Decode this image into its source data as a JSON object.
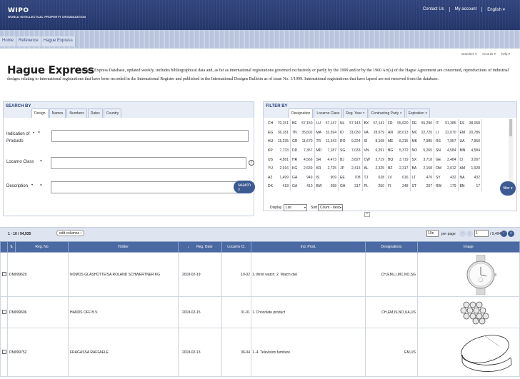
{
  "header": {
    "logo_main": "WIPO",
    "logo_sub": "WORLD INTELLECTUAL PROPERTY ORGANIZATION",
    "links": [
      "Contact Us",
      "My account",
      "English"
    ]
  },
  "breadcrumb": [
    "Home",
    "Reference",
    "Hague Express"
  ],
  "helpers": [
    "searches",
    "records",
    "help"
  ],
  "page": {
    "title": "Hague Express",
    "description": "The Hague Express Database, updated weekly, includes bibliographical data and, as far as international registrations governed exclusively or partly by the 1999 and/or by the 1960 Act(s) of the Hague Agreement are concerned, reproductions of industrial designs relating to international registrations that have been recorded in the International Register and published in the International Designs Bulletin as of issue No. 1/1999. International registrations that have lapsed are not removed from the database."
  },
  "search_by": {
    "title": "SEARCH BY",
    "tabs": [
      "Design",
      "Names",
      "Numbers",
      "Dates",
      "Country"
    ],
    "fields": [
      {
        "label": "Indication of Products",
        "op": "="
      },
      {
        "label": "Locarno Class",
        "op": "="
      },
      {
        "label": "Description",
        "op": "="
      }
    ],
    "search_button": "search"
  },
  "filter_by": {
    "title": "FILTER BY",
    "tabs": [
      "Designation",
      "Locarno Class",
      "Reg. Year",
      "Contracting Party",
      "Expiration"
    ],
    "rows": [
      [
        [
          "CH",
          "70,151"
        ],
        [
          "BE",
          "57,150"
        ],
        [
          "LU",
          "57,147"
        ],
        [
          "NL",
          "57,143"
        ],
        [
          "BX",
          "57,141"
        ],
        [
          "FR",
          "55,620"
        ],
        [
          "DE",
          "55,290"
        ],
        [
          "IT",
          "51,385"
        ],
        [
          "ES",
          "38,068"
        ]
      ],
      [
        [
          "EG",
          "36,181"
        ],
        [
          "TN",
          "35,602"
        ],
        [
          "MA",
          "32,594"
        ],
        [
          "ID",
          "31,030"
        ],
        [
          "VA",
          "28,679"
        ],
        [
          "AN",
          "28,013"
        ],
        [
          "MC",
          "22,720"
        ],
        [
          "LI",
          "22,070"
        ],
        [
          "EM",
          "20,786"
        ]
      ],
      [
        [
          "HU",
          "15,235"
        ],
        [
          "GR",
          "11,670"
        ],
        [
          "TR",
          "11,343"
        ],
        [
          "RO",
          "9,224"
        ],
        [
          "SI",
          "8,168"
        ],
        [
          "ME",
          "8,215"
        ],
        [
          "MK",
          "7,985"
        ],
        [
          "RS",
          "7,957"
        ],
        [
          "UA",
          "7,950"
        ]
      ],
      [
        [
          "KP",
          "7,733"
        ],
        [
          "DD",
          "7,357"
        ],
        [
          "MD",
          "7,187"
        ],
        [
          "SG",
          "7,033"
        ],
        [
          "VN",
          "6,291"
        ],
        [
          "BG",
          "5,372"
        ],
        [
          "NO",
          "5,265"
        ],
        [
          "SN",
          "4,584"
        ],
        [
          "MN",
          "4,584"
        ]
      ],
      [
        [
          "US",
          "4,581"
        ],
        [
          "HR",
          "4,566"
        ],
        [
          "SR",
          "4,473"
        ],
        [
          "BJ",
          "3,827"
        ],
        [
          "CW",
          "3,719"
        ],
        [
          "BQ",
          "3,719"
        ],
        [
          "SX",
          "3,718"
        ],
        [
          "GE",
          "3,484"
        ],
        [
          "CI",
          "3,007"
        ]
      ],
      [
        [
          "YU",
          "2,916"
        ],
        [
          "KG",
          "2,639"
        ],
        [
          "KR",
          "2,725"
        ],
        [
          "JP",
          "2,413"
        ],
        [
          "AL",
          "2,325"
        ],
        [
          "BZ",
          "2,317"
        ],
        [
          "BA",
          "2,158"
        ],
        [
          "OM",
          "2,012"
        ],
        [
          "AM",
          "1,928"
        ]
      ],
      [
        [
          "AZ",
          "1,499"
        ],
        [
          "GA",
          "949"
        ],
        [
          "IS",
          "909"
        ],
        [
          "EE",
          "708"
        ],
        [
          "TJ",
          "628"
        ],
        [
          "LV",
          "616"
        ],
        [
          "LT",
          "470"
        ],
        [
          "SY",
          "432"
        ],
        [
          "NA",
          "432"
        ]
      ],
      [
        [
          "DK",
          "418"
        ],
        [
          "GA",
          "410"
        ],
        [
          "BW",
          "398"
        ],
        [
          "GH",
          "317"
        ],
        [
          "PL",
          "250"
        ],
        [
          "FI",
          "248"
        ],
        [
          "ST",
          "207"
        ],
        [
          "RW",
          "179"
        ],
        [
          "BN",
          "17"
        ]
      ]
    ],
    "display_label": "Display",
    "display_value": "List",
    "sort_label": "Sort",
    "sort_value": "Count - desc",
    "filter_button": "filter"
  },
  "results": {
    "count": "1 - 10 / 94,935",
    "edit_columns": "edit columns",
    "per_page_value": "10",
    "per_page_label": "per page",
    "page_value": "1",
    "page_total": "/ 9,494",
    "columns": [
      "",
      "Reg. No",
      "Holder",
      "Reg. Date",
      "Locarno Cl.",
      "Ind. Prod.",
      "Designations",
      "Image"
    ],
    "rows": [
      {
        "reg_no": "DM099629",
        "holder": "NOMOS GLASHÜTTE/SA ROLAND SCHWERTNER KG",
        "reg_date": "2018-02-19",
        "locarno": "10-02",
        "ind_prod": "1. Wrist watch; 2. Watch dial",
        "designations": "CH,EM,LI,MC,NO,SG"
      },
      {
        "reg_no": "DM099606",
        "holder": "HANDS OFF B.V.",
        "reg_date": "2018-02-15",
        "locarno": "01-01",
        "ind_prod": "1. Chocolate product",
        "designations": "CH,EM,IS,NO,UA,US"
      },
      {
        "reg_no": "DM099752",
        "holder": "FRAGASSA RAFFAELE",
        "reg_date": "2018-02-13",
        "locarno": "06-04",
        "ind_prod": "1.-4. Television furniture",
        "designations": "EM,US"
      }
    ]
  },
  "colors": {
    "header_bg": "#2c4080",
    "accent": "#3d5b93",
    "table_header": "#4b69a2"
  }
}
